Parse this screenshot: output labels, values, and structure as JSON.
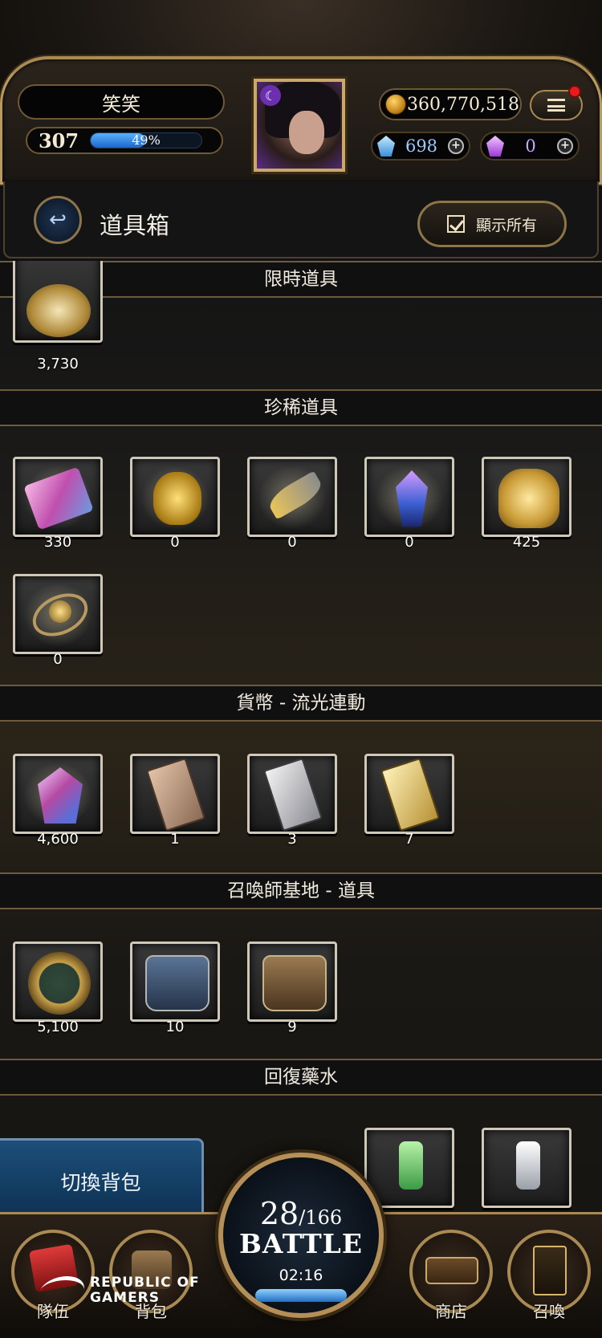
{
  "player": {
    "name": "笑笑",
    "level": "307",
    "xp_percent_text": "49%",
    "xp_fraction": 0.49
  },
  "currency": {
    "coins": "360,770,518",
    "blue_gems": "698",
    "purple_gems": "0"
  },
  "header": {
    "title": "道具箱",
    "show_all_label": "顯示所有"
  },
  "sections": [
    {
      "title": "限時道具",
      "items": [
        {
          "icon": "gold-crest-medallion",
          "count": "3,730"
        }
      ]
    },
    {
      "title": "珍稀道具",
      "items": [
        {
          "icon": "pink-sigil-card",
          "count": "330"
        },
        {
          "icon": "golden-heart",
          "count": "0"
        },
        {
          "icon": "golden-horn",
          "count": "0"
        },
        {
          "icon": "blue-crystal",
          "count": "0"
        },
        {
          "icon": "golden-wheat-sack",
          "count": "425"
        },
        {
          "icon": "orbit-relic",
          "count": "0"
        }
      ]
    },
    {
      "title": "貨幣 - 流光連動",
      "items": [
        {
          "icon": "prism-gem",
          "count": "4,600"
        },
        {
          "icon": "bronze-card",
          "count": "1"
        },
        {
          "icon": "silver-card",
          "count": "3"
        },
        {
          "icon": "gold-card",
          "count": "7"
        }
      ]
    },
    {
      "title": "召喚師基地 - 道具",
      "items": [
        {
          "icon": "chair-medal",
          "count": "5,100"
        },
        {
          "icon": "blue-satchel",
          "count": "10"
        },
        {
          "icon": "brown-satchel",
          "count": "9"
        }
      ]
    },
    {
      "title": "回復藥水",
      "items": []
    }
  ],
  "switch_bag_label": "切換背包",
  "battle": {
    "stamina_current": "28",
    "stamina_max": "/166",
    "label": "BATTLE",
    "timer": "02:16"
  },
  "nav": {
    "team": "隊伍",
    "bag": "背包",
    "shop": "商店",
    "summon": "召喚"
  },
  "overlay": {
    "brand": "REPUBLIC OF GAMERS"
  },
  "colors": {
    "gold_trim": "#a98a52",
    "xp_bar": "#2f86e8",
    "switch_bag": "#1d4f7a"
  }
}
